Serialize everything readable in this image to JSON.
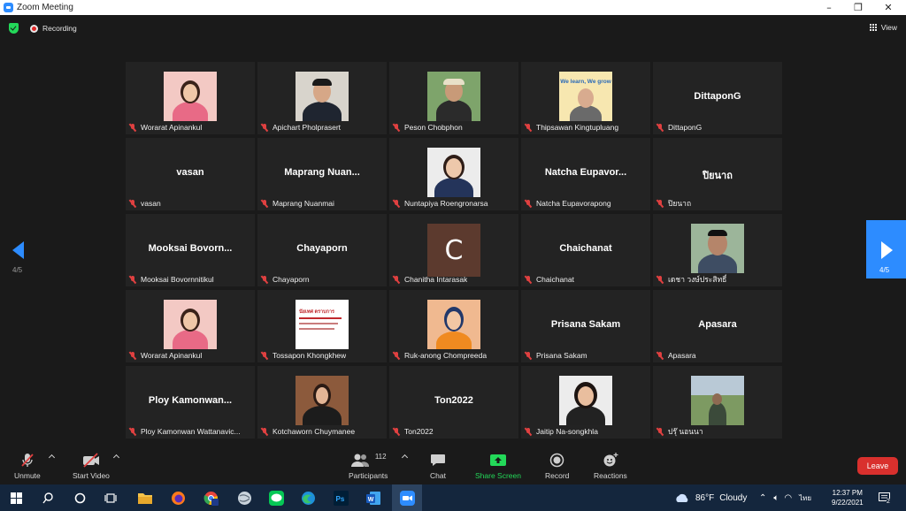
{
  "window": {
    "title": "Zoom Meeting",
    "minimize": "–",
    "restore": "❐",
    "close": "✕"
  },
  "topbar": {
    "recording_label": "Recording",
    "view_label": "View"
  },
  "nav": {
    "left_page": "4/5",
    "right_page": "4/5"
  },
  "tiles": [
    {
      "label": "Worarat Apinankul",
      "display_name": ""
    },
    {
      "label": "Apichart Pholprasert",
      "display_name": ""
    },
    {
      "label": "Peson Chobphon",
      "display_name": ""
    },
    {
      "label": "Thipsawan Kingtupluang",
      "display_name": ""
    },
    {
      "label": "DittaponG",
      "display_name": "DittaponG"
    },
    {
      "label": "vasan",
      "display_name": "vasan"
    },
    {
      "label": "Maprang Nuanmai",
      "display_name": "Maprang  Nuan..."
    },
    {
      "label": "Nuntapiya Roengronarsa",
      "display_name": ""
    },
    {
      "label": "Natcha Eupavorapong",
      "display_name": "Natcha  Eupavor..."
    },
    {
      "label": "ปิยนาถ",
      "display_name": "ปิยนาถ"
    },
    {
      "label": "Mooksai Bovornnitikul",
      "display_name": "Mooksai  Bovorn..."
    },
    {
      "label": "Chayaporn",
      "display_name": "Chayaporn"
    },
    {
      "label": "Chanitha Intarasak",
      "display_name": "",
      "initial": "C"
    },
    {
      "label": "Chaichanat",
      "display_name": "Chaichanat"
    },
    {
      "label": "เดชา วงษ์ประสิทธิ์",
      "display_name": ""
    },
    {
      "label": "Worarat Apinankul",
      "display_name": ""
    },
    {
      "label": "Tossapon Khongkhew",
      "display_name": ""
    },
    {
      "label": "Ruk-anong Chompreeda",
      "display_name": ""
    },
    {
      "label": "Prisana Sakam",
      "display_name": "Prisana Sakam"
    },
    {
      "label": "Apasara",
      "display_name": "Apasara"
    },
    {
      "label": "Ploy Kamonwan Wattanavic...",
      "display_name": "Ploy  Kamonwan..."
    },
    {
      "label": "Kotchaworn Chuymanee",
      "display_name": ""
    },
    {
      "label": "Ton2022",
      "display_name": "Ton2022"
    },
    {
      "label": "Jaitip Na-songkhla",
      "display_name": ""
    },
    {
      "label": "ปรุ๊ นอนนา",
      "display_name": ""
    }
  ],
  "photo_text": {
    "thipsawan_banner": "We learn, We grow",
    "tossapon_doc": "นัยเทศ ตราบการ"
  },
  "toolbar": {
    "unmute": "Unmute",
    "start_video": "Start Video",
    "participants": "Participants",
    "participants_count": "112",
    "chat": "Chat",
    "share_screen": "Share Screen",
    "record": "Record",
    "reactions": "Reactions",
    "leave": "Leave"
  },
  "taskbar": {
    "weather_temp": "86°F",
    "weather_text": "Cloudy",
    "language": "ไทย",
    "time": "12:37 PM",
    "date": "9/22/2021",
    "notification_count": "2"
  },
  "colors": {
    "accent": "#2d8cff",
    "leave": "#d9302d",
    "share": "#23d959",
    "muted": "#e04040"
  }
}
